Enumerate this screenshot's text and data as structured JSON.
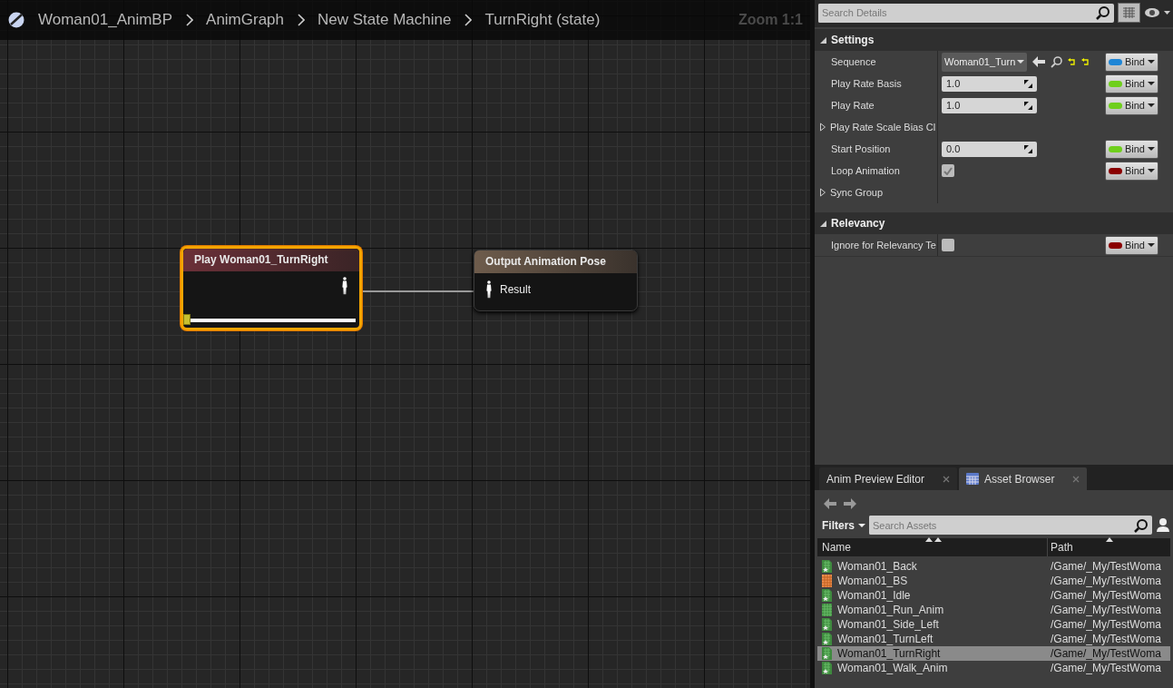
{
  "breadcrumb": {
    "items": [
      "Woman01_AnimBP",
      "AnimGraph",
      "New State Machine",
      "TurnRight (state)"
    ],
    "zoom": "Zoom 1:1"
  },
  "graph": {
    "nodes": [
      {
        "kind": "player",
        "title": "Play Woman01_TurnRight",
        "selected": true,
        "level": 0
      },
      {
        "kind": "output",
        "title": "Output Animation Pose",
        "selected": false,
        "pin": "Result"
      }
    ]
  },
  "details": {
    "search": {
      "placeholder": "Search Details"
    },
    "sections": [
      {
        "title": "Settings",
        "expanded": true,
        "rows": [
          {
            "kind": "asset",
            "label": "Sequence",
            "value": "Woman01_Turn",
            "bind": "Bind",
            "color": "#1f86d6"
          },
          {
            "kind": "number",
            "label": "Play Rate Basis",
            "value": "1.0",
            "bind": "Bind",
            "color": "#6fcf1c"
          },
          {
            "kind": "number",
            "label": "Play Rate",
            "value": "1.0",
            "bind": "Bind",
            "color": "#6fcf1c"
          },
          {
            "kind": "group",
            "label": "Play Rate Scale Bias Cl",
            "expanded": false
          },
          {
            "kind": "number",
            "label": "Start Position",
            "value": "0.0",
            "bind": "Bind",
            "color": "#6fcf1c"
          },
          {
            "kind": "checkbox",
            "label": "Loop Animation",
            "checked": true,
            "bind": "Bind",
            "color": "#8a0000"
          },
          {
            "kind": "group",
            "label": "Sync Group",
            "expanded": false
          }
        ]
      },
      {
        "title": "Relevancy",
        "expanded": true,
        "rows": [
          {
            "kind": "checkbox",
            "label": "Ignore for Relevancy Te",
            "checked": false,
            "bind": "Bind",
            "color": "#8a0000"
          }
        ]
      }
    ]
  },
  "bottom_tabs": [
    {
      "label": "Anim Preview Editor",
      "selected": false
    },
    {
      "label": "Asset Browser",
      "selected": true
    }
  ],
  "asset_browser": {
    "filters": "Filters",
    "search": {
      "placeholder": "Search Assets"
    },
    "columns": [
      "Name",
      "Path"
    ],
    "rows": [
      {
        "kind": "sequence",
        "name": "Woman01_Back",
        "path": "/Game/_My/TestWoma",
        "selected": false
      },
      {
        "kind": "blendspace",
        "name": "Woman01_BS",
        "path": "/Game/_My/TestWoma",
        "selected": false
      },
      {
        "kind": "sequence",
        "name": "Woman01_Idle",
        "path": "/Game/_My/TestWoma",
        "selected": false
      },
      {
        "kind": "composite",
        "name": "Woman01_Run_Anim",
        "path": "/Game/_My/TestWoma",
        "selected": false
      },
      {
        "kind": "sequence",
        "name": "Woman01_Side_Left",
        "path": "/Game/_My/TestWoma",
        "selected": false
      },
      {
        "kind": "sequence",
        "name": "Woman01_TurnLeft",
        "path": "/Game/_My/TestWoma",
        "selected": false
      },
      {
        "kind": "sequence",
        "name": "Woman01_TurnRight",
        "path": "/Game/_My/TestWoma",
        "selected": true
      },
      {
        "kind": "sequence",
        "name": "Woman01_Walk_Anim",
        "path": "/Game/_My/TestWoma",
        "selected": false
      }
    ]
  }
}
